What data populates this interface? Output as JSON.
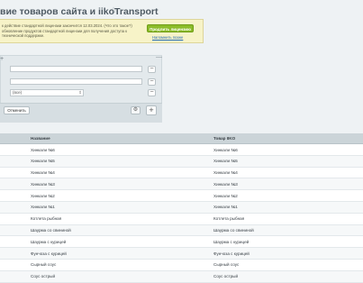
{
  "page": {
    "title": "вие товаров сайта и iikoTransport",
    "star_icon": "star-icon"
  },
  "notice": {
    "text": "к действие стандартной лицензии закончится 12.03.2024. (Что это такое?) обновление продуктов стандартной лицензии для получения доступа к технической поддержке.",
    "link": "Что это такое?",
    "buy_label": "Продлить лицензию",
    "extend_label": "Напомнить позже"
  },
  "filter": {
    "select_value": "(все)",
    "cancel_label": "Отменить",
    "plus": "+",
    "minus": "−",
    "add": "+"
  },
  "table": {
    "columns": [
      "Название",
      "Товар IIKO"
    ],
    "rows": [
      [
        "Хинкали №6",
        "Хинкали №6"
      ],
      [
        "Хинкали №5",
        "Хинкали №5"
      ],
      [
        "Хинкали №4",
        "Хинкали №4"
      ],
      [
        "Хинкали №3",
        "Хинкали №3"
      ],
      [
        "Хинкали №2",
        "Хинкали №2"
      ],
      [
        "Хинкали №1",
        "Хинкали №1"
      ],
      [
        "Котлета рыбная",
        "Котлета рыбная"
      ],
      [
        "Шаурма со свининой",
        "Шаурма со свининой"
      ],
      [
        "Шаурма с курицей",
        "Шаурма с курицей"
      ],
      [
        "Фунчоза с курицей",
        "Фунчоза с курицей"
      ],
      [
        "Сырный соус",
        "Сырный соус"
      ],
      [
        "Соус острый",
        "Соус острый"
      ]
    ]
  }
}
